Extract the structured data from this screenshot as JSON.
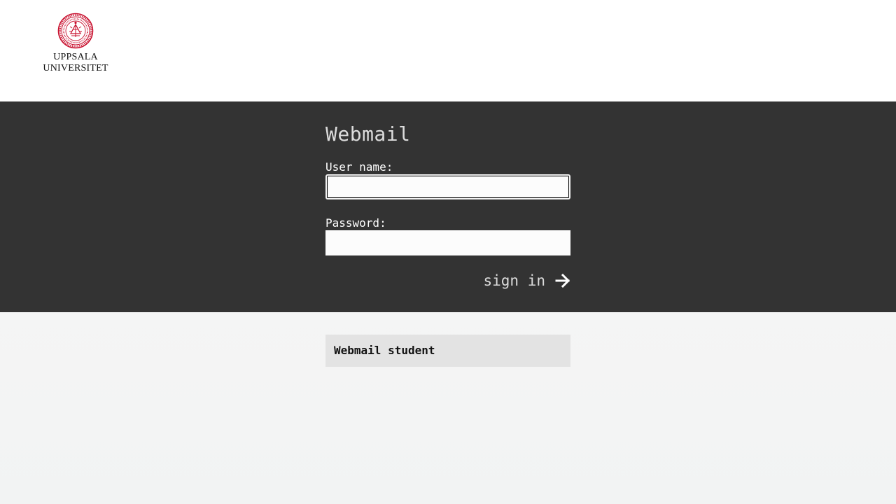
{
  "header": {
    "logo_line1": "UPPSALA",
    "logo_line2": "UNIVERSITET",
    "seal_icon": "university-seal-icon",
    "seal_color": "#c8102e"
  },
  "login": {
    "title": "Webmail",
    "username_label": "User name:",
    "username_value": "",
    "password_label": "Password:",
    "password_value": "",
    "signin_label": "sign in",
    "signin_icon": "arrow-right-icon"
  },
  "links": [
    {
      "label": "Webmail student"
    }
  ],
  "colors": {
    "band": "#333333",
    "link_bg": "#e3e3e3"
  }
}
